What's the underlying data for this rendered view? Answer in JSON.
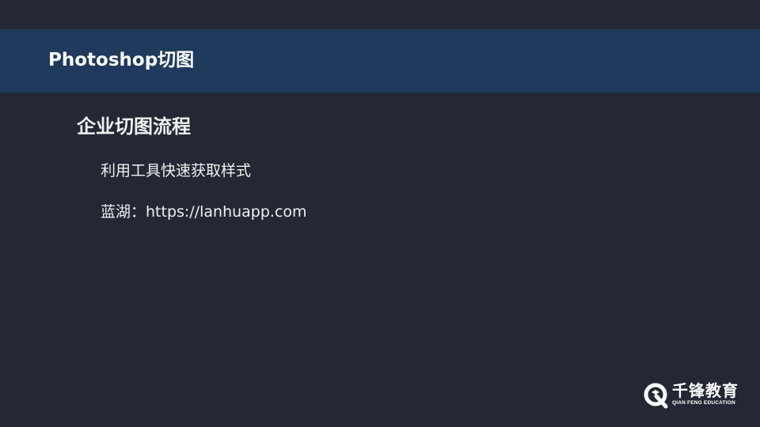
{
  "slide": {
    "header_title": "Photoshop切图",
    "section_heading": "企业切图流程",
    "bullets": [
      "利用工具快速获取样式",
      "蓝湖：https://lanhuapp.com"
    ]
  },
  "logo": {
    "name_cn": "千锋教育",
    "name_en": "QIAN FENG EDUCATION",
    "icon": "qianfeng-logo-icon"
  },
  "colors": {
    "background": "#232834",
    "header_band": "#1f3a5c",
    "text": "#ffffff"
  }
}
